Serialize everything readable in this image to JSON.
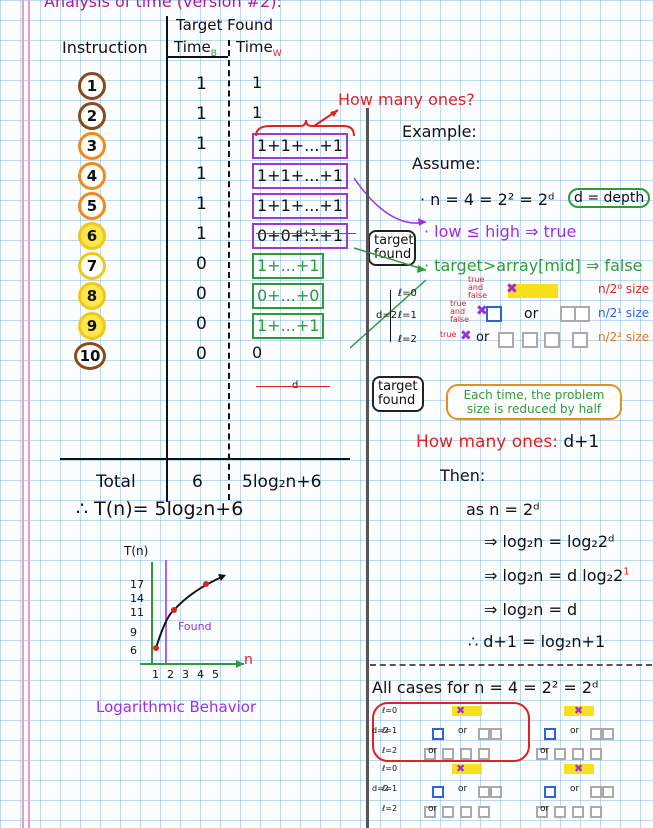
{
  "title": "Analysis of time (version #2):",
  "table": {
    "header_top": "Target Found",
    "col_instruction": "Instruction",
    "col_time_b": "Time",
    "col_time_b_sub": "B",
    "col_time_w": "Time",
    "col_time_w_sub": "W",
    "rows": [
      {
        "num": "1",
        "tb": "1",
        "tw": "1"
      },
      {
        "num": "2",
        "tb": "1",
        "tw": "1"
      },
      {
        "num": "3",
        "tb": "1",
        "tw": "1+1+...+1"
      },
      {
        "num": "4",
        "tb": "1",
        "tw": "1+1+...+1"
      },
      {
        "num": "5",
        "tb": "1",
        "tw": "1+1+...+1"
      },
      {
        "num": "6",
        "tb": "1",
        "tw": "0+0+...+1"
      },
      {
        "num": "7",
        "tb": "0",
        "tw": "1+...+1"
      },
      {
        "num": "8",
        "tb": "0",
        "tw": "0+...+0"
      },
      {
        "num": "9",
        "tb": "0",
        "tw": "1+...+1"
      },
      {
        "num": "10",
        "tb": "0",
        "tw": "0"
      }
    ],
    "d_plus_1": "d+1",
    "d_label": "d",
    "total_label": "Total",
    "total_b": "6",
    "total_w": "5log₂n+6"
  },
  "how_many_top": "How many ones?",
  "target_found_1": "target found",
  "therefore_eq": "∴ T(n)= 5log₂n+6",
  "graph": {
    "ylabel": "T(n)",
    "yticks": [
      "17",
      "14",
      "11",
      "9",
      "6"
    ],
    "xticks": [
      "1",
      "2",
      "3",
      "4",
      "5"
    ],
    "xlabel": "n",
    "found": "Found",
    "caption": "Logarithmic Behavior"
  },
  "right": {
    "example": "Example:",
    "assume": "Assume:",
    "line1": "· n = 4 = 2² = 2ᵈ",
    "depth_box": "d = depth",
    "line2": "· low ≤ high ⇒ true",
    "line3": "· target>array[mid] ⇒ false",
    "levels": [
      "ℓ=0",
      "ℓ=1",
      "ℓ=2"
    ],
    "d2": "d=2",
    "true_and_false": "true and false",
    "true": "true",
    "or": "or",
    "size0": "n/2⁰ size",
    "size1": "n/2¹ size",
    "size2": "n/2² size",
    "target_found_2": "target found",
    "each_time": "Each time, the problem size is reduced by half",
    "how_many_ones": "How many ones:",
    "d_plus_1": "d+1",
    "then": "Then:",
    "as": "as  n = 2ᵈ",
    "step1": "⇒ log₂n = log₂2ᵈ",
    "step2": "⇒ log₂n = d log₂2",
    "step2_one": "1",
    "step3": "⇒ log₂n = d",
    "step4": "∴  d+1 = log₂n+1",
    "all_cases": "All  cases for  n = 4 = 2² = 2ᵈ",
    "mini_levels": [
      "ℓ=0",
      "ℓ=1",
      "ℓ=2"
    ],
    "mini_d2": "d=2",
    "mini_or": "or"
  },
  "colors": {
    "red": "#e0231f",
    "purple": "#9b2fe0",
    "green": "#2e9a3a",
    "blue": "#2a64d6",
    "orange": "#e88e1a",
    "yellow": "#f8e11a"
  }
}
